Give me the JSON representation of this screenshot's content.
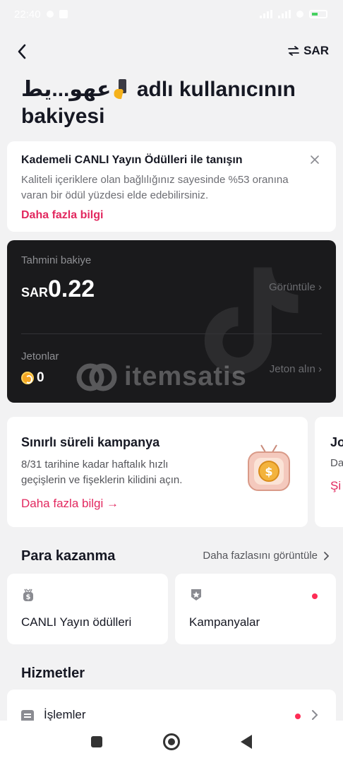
{
  "status_bar": {
    "time": "22:40"
  },
  "header": {
    "currency_label": "SAR"
  },
  "page": {
    "title_name": "عهو...يط",
    "title_rest": " adlı kullanıcının bakiyesi"
  },
  "info_card": {
    "title": "Kademeli CANLI Yayın Ödülleri ile tanışın",
    "body": "Kaliteli içeriklere olan bağlılığınız sayesinde %53 oranına varan bir ödül yüzdesi elde edebilirsiniz.",
    "link": "Daha fazla bilgi"
  },
  "balance": {
    "label": "Tahmini bakiye",
    "currency": "SAR",
    "amount": "0.22",
    "view_link": "Görüntüle ›",
    "coins_label": "Jetonlar",
    "coins_value": "0",
    "buy_link": "Jeton alın ›",
    "watermark_text": "itemsatis"
  },
  "promo": {
    "title": "Sınırlı süreli kampanya",
    "body": "8/31 tarihine kadar haftalık hızlı geçişlerin ve fişeklerin kilidini açın.",
    "link": "Daha fazla bilgi →"
  },
  "promo2": {
    "title": "Jo",
    "body": "Da",
    "link": "Şi"
  },
  "monetization": {
    "heading": "Para kazanma",
    "more": "Daha fazlasını görüntüle",
    "tiles": [
      {
        "label": "CANLI Yayın ödülleri",
        "icon": "money-bag-icon"
      },
      {
        "label": "Kampanyalar",
        "icon": "badge-star-icon"
      }
    ]
  },
  "services": {
    "heading": "Hizmetler",
    "items": [
      {
        "label": "İşlemler",
        "icon": "list-icon"
      }
    ]
  },
  "colors": {
    "accent": "#e2285f",
    "dot": "#fe2c55",
    "dark_card": "#1a1a1c",
    "background": "#f2f2f3"
  }
}
